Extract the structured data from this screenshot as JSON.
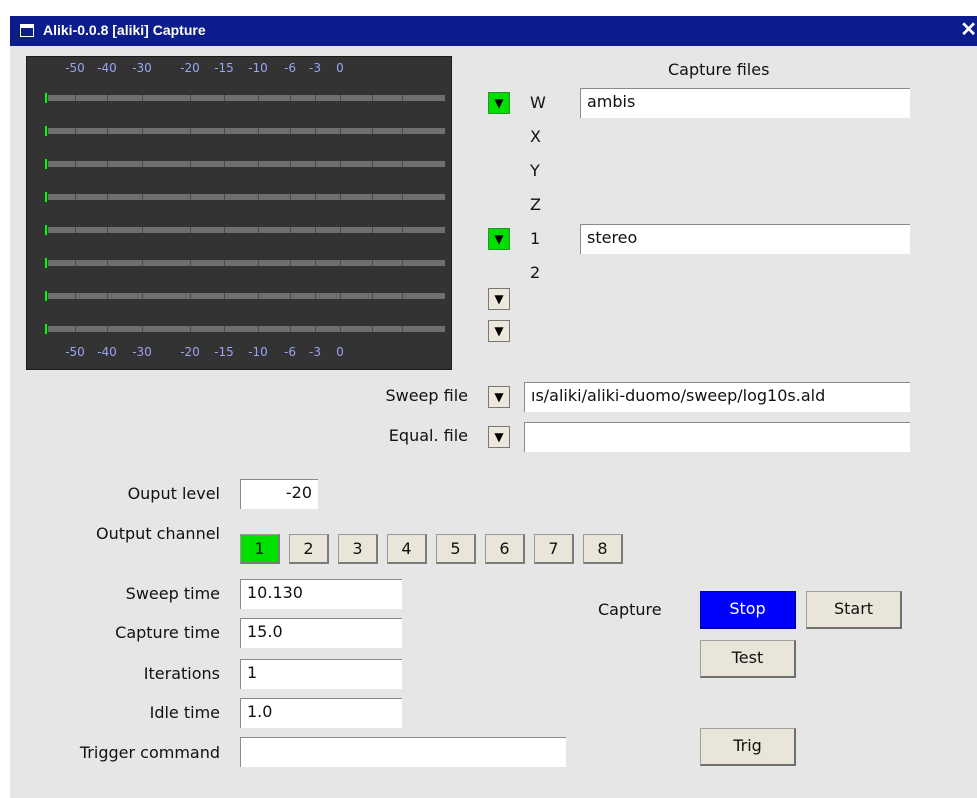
{
  "window": {
    "title": "Aliki-0.0.8  [aliki] Capture",
    "close_glyph": "✕"
  },
  "meter": {
    "scale_labels": [
      "-50",
      "-40",
      "-30",
      "-20",
      "-15",
      "-10",
      "-6",
      "-3",
      "0"
    ],
    "channels": 8,
    "colors": {
      "background": "#333333",
      "bar": "#6f6f6f",
      "peak": "#00ff00",
      "scale_text": "#9aa4f0"
    }
  },
  "capture_files": {
    "heading": "Capture files",
    "rows": [
      {
        "label": "W",
        "enabled": true,
        "file": "ambis"
      },
      {
        "label": "X",
        "enabled": false,
        "file": ""
      },
      {
        "label": "Y",
        "enabled": false,
        "file": ""
      },
      {
        "label": "Z",
        "enabled": false,
        "file": ""
      },
      {
        "label": "1",
        "enabled": true,
        "file": "stereo"
      },
      {
        "label": "2",
        "enabled": false,
        "file": ""
      }
    ],
    "extra_dropdowns": 2
  },
  "sweep_file": {
    "label": "Sweep file",
    "value": "ıs/aliki/aliki-duomo/sweep/log10s.ald"
  },
  "equal_file": {
    "label": "Equal. file",
    "value": ""
  },
  "output_level": {
    "label": "Ouput level",
    "value": "-20"
  },
  "output_channel": {
    "label": "Output channel",
    "options": [
      "1",
      "2",
      "3",
      "4",
      "5",
      "6",
      "7",
      "8"
    ],
    "selected": "1"
  },
  "sweep_time": {
    "label": "Sweep time",
    "value": "10.130"
  },
  "capture_time": {
    "label": "Capture time",
    "value": "15.0"
  },
  "iterations": {
    "label": "Iterations",
    "value": "1"
  },
  "idle_time": {
    "label": "Idle time",
    "value": "1.0"
  },
  "trigger_command": {
    "label": "Trigger command",
    "value": ""
  },
  "capture_controls": {
    "label": "Capture",
    "stop": "Stop",
    "start": "Start",
    "test": "Test",
    "trig": "Trig"
  },
  "colors": {
    "titlebar": "#0b1c8c",
    "window_bg": "#e6e6e6",
    "active_green": "#00e000",
    "stop_blue": "#0000ff"
  },
  "icons": {
    "dropdown": "triangle-down-icon",
    "close": "close-icon",
    "window_menu": "window-menu-icon"
  }
}
